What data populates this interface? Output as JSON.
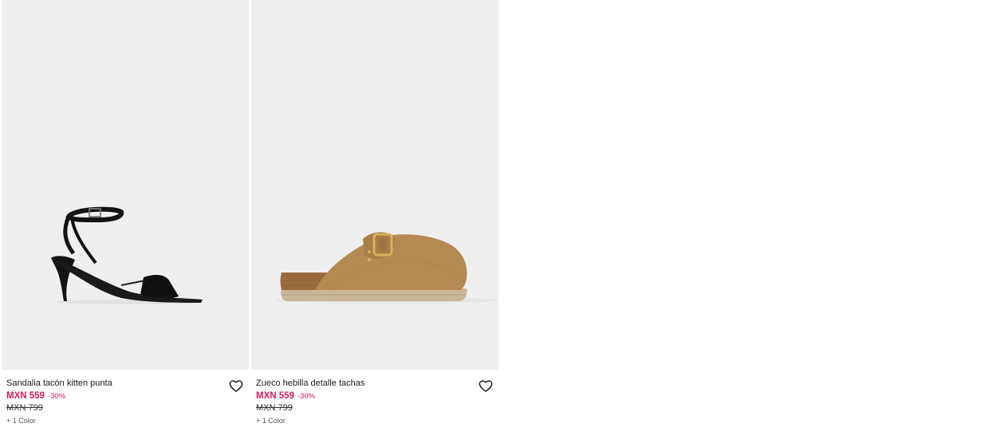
{
  "products": [
    {
      "name": "Sandalia tacón kitten punta",
      "sale_price": "MXN 559",
      "discount": "-30%",
      "old_price": "MXN 799",
      "colors": "+ 1 Color",
      "image_icon": "black-kitten-heel-sandal"
    },
    {
      "name": "Zueco hebilla detalle tachas",
      "sale_price": "MXN 559",
      "discount": "-30%",
      "old_price": "MXN 799",
      "colors": "+ 1 Color",
      "image_icon": "tan-suede-buckle-clog"
    }
  ],
  "colors": {
    "sale": "#d91a5b",
    "image_bg": "#efefef"
  }
}
